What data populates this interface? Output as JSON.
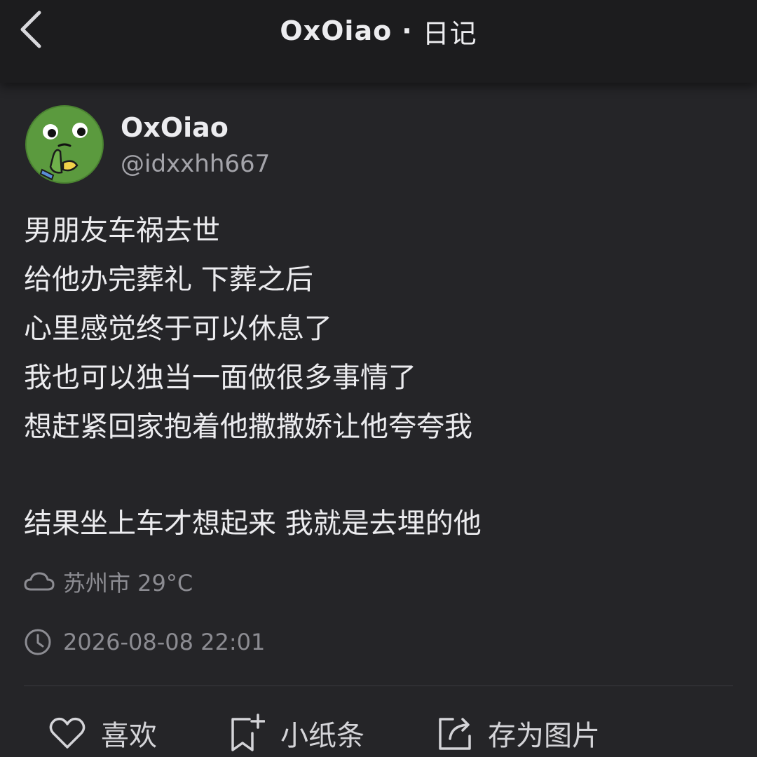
{
  "header": {
    "back_icon": "chevron-left-icon",
    "account_name": "OxOiao",
    "separator": "·",
    "section": "日记"
  },
  "author": {
    "avatar_icon": "green-frog-avatar",
    "name": "OxOiao",
    "handle": "@idxxhh667"
  },
  "post": {
    "lines": [
      "男朋友车祸去世",
      "给他办完葬礼 下葬之后",
      "心里感觉终于可以休息了",
      "我也可以独当一面做很多事情了",
      "想赶紧回家抱着他撒撒娇让他夸夸我",
      "结果坐上车才想起来 我就是去埋的他"
    ],
    "location": "苏州市 29°C",
    "location_icon": "cloud-icon",
    "timestamp": "2026-08-08 22:01",
    "time_icon": "clock-icon"
  },
  "actions": {
    "like_label": "喜欢",
    "like_icon": "heart-icon",
    "note_label": "小纸条",
    "note_icon": "bookmark-plus-icon",
    "save_label": "存为图片",
    "save_icon": "share-export-icon"
  },
  "colors": {
    "background": "#252528",
    "header_background": "#1c1c1e",
    "text_primary": "#ececef",
    "text_secondary": "#8c8c92",
    "avatar_green": "#5b9a3e"
  }
}
